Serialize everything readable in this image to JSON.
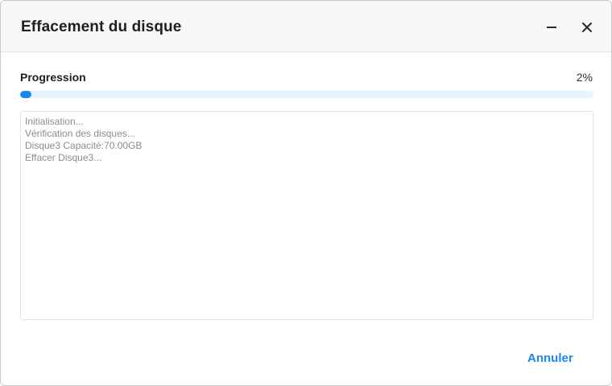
{
  "window": {
    "title": "Effacement du disque"
  },
  "progress": {
    "label": "Progression",
    "value_text": "2%",
    "fraction": 0.02,
    "fill_color": "#1a86f0",
    "track_color": "#e8f4fd"
  },
  "log": {
    "lines": [
      "Initialisation...",
      "Vérification des disques...",
      "Disque3 Capacité:70.00GB",
      "Effacer Disque3..."
    ]
  },
  "footer": {
    "cancel_label": "Annuler"
  },
  "icons": {
    "minimize": "minimize-icon",
    "close": "close-icon"
  }
}
